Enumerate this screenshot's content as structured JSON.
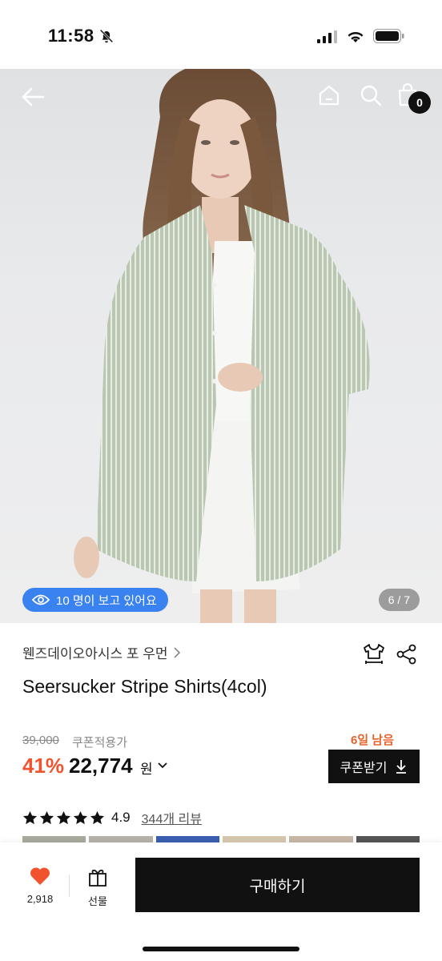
{
  "status_bar": {
    "time": "11:58",
    "icons": [
      "bell-off-icon",
      "signal-icon",
      "wifi-icon",
      "battery-icon"
    ]
  },
  "nav": {
    "cart_count": "0",
    "icons": [
      "back-arrow-icon",
      "home-icon",
      "search-icon",
      "shopping-bag-icon"
    ]
  },
  "hero": {
    "viewer_text": "10 명이 보고 있어요",
    "page_indicator": "6 / 7"
  },
  "product": {
    "brand": "웬즈데이오아시스 포 우먼",
    "title": "Seersucker Stripe Shirts(4col)",
    "original_price": "39,000",
    "coupon_note": "쿠폰적용가",
    "discount": "41%",
    "price": "22,774",
    "currency": "원",
    "days_left": "6일 남음",
    "coupon_button": "쿠폰받기",
    "rating": "4.9",
    "stars": 5,
    "review_link": "344개 리뷰"
  },
  "bottom_bar": {
    "like_count": "2,918",
    "gift_label": "선물",
    "buy_label": "구매하기"
  },
  "colors": {
    "accent_discount": "#f0532d",
    "days_left": "#e8632c",
    "viewer_badge": "#3a82f0",
    "heart": "#f0532d",
    "button_dark": "#111111"
  }
}
